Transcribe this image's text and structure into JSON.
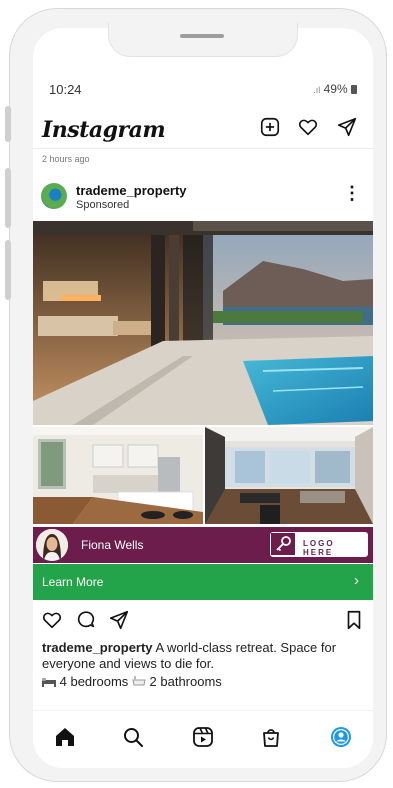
{
  "status": {
    "time": "10:24",
    "battery": "49%"
  },
  "header": {
    "app_name": "Instagram",
    "icons": [
      "plus-square-icon",
      "heart-icon",
      "send-icon"
    ]
  },
  "feed": {
    "time_ago": "2 hours ago"
  },
  "post": {
    "username": "trademe_property",
    "sponsored_label": "Sponsored",
    "more_glyph": "⋮",
    "agent_name": "Fiona Wells",
    "logo_placeholder": "LOGO HERE",
    "cta_label": "Learn More",
    "cta_chevron": "›",
    "caption_user": "trademe_property",
    "caption_text": " A world-class retreat. Space for everyone and views to die for.",
    "bedrooms": "4 bedrooms",
    "bathrooms": "2 bathrooms"
  },
  "nav": {
    "items": [
      "home-icon",
      "search-icon",
      "reels-icon",
      "shop-icon",
      "profile-icon"
    ]
  },
  "colors": {
    "agent_bar": "#6d1d4c",
    "cta": "#23a34a",
    "profile_active": "#1d98e3"
  }
}
